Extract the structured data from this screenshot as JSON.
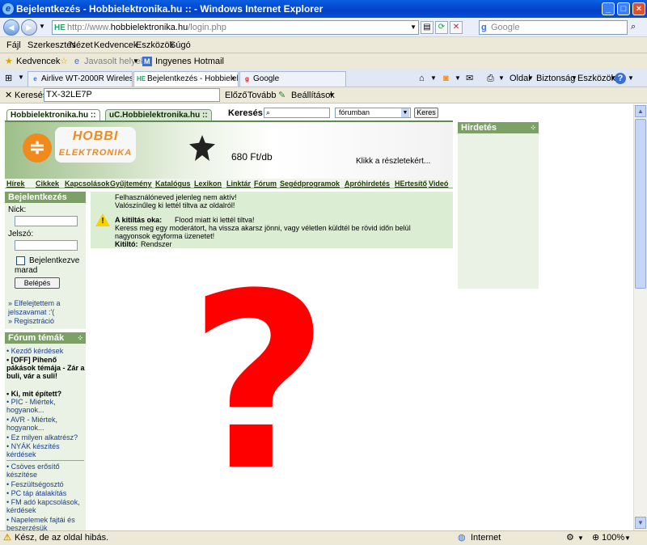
{
  "window": {
    "title": "Bejelentkezés - Hobbielektronika.hu :: - Windows Internet Explorer"
  },
  "address": {
    "site_badge": "HE",
    "prefix": "http://www.",
    "domain": "hobbielektronika.hu",
    "path": "/login.php"
  },
  "search_engine": {
    "placeholder": "Google"
  },
  "menu": [
    "Fájl",
    "Szerkesztés",
    "Nézet",
    "Kedvencek",
    "Eszközök",
    "Súgó"
  ],
  "favorites": {
    "label": "Kedvencek",
    "suggested": "Javasolt helyek",
    "hotmail": "Ingyenes Hotmail"
  },
  "tabs": [
    {
      "label": "Airlive WT-2000R Wireless Br..."
    },
    {
      "label": "Bejelentkezés - Hobbielek..."
    },
    {
      "label": "Google"
    }
  ],
  "command_bar": {
    "page": "Oldal",
    "safety": "Biztonság",
    "tools": "Eszközök"
  },
  "find_bar": {
    "label": "Keresés:",
    "value": "TX-32LE7P",
    "prev": "Előző",
    "next": "Tovább",
    "settings": "Beállítások"
  },
  "site": {
    "tabs": [
      "Hobbielektronika.hu ::",
      "uC.Hobbielektronika.hu ::"
    ],
    "search_label": "Keresés:",
    "search_scope": "fórumban",
    "search_button": "Keres",
    "logo_line1": "HOBBI",
    "logo_line2": "ELEKTRONIKA",
    "ad_price": "680 Ft/db",
    "ad_details": "Klikk a részletekért...",
    "nav": [
      "Hírek",
      "Cikkek",
      "Kapcsolások",
      "Gyűjtemény",
      "Katalógus",
      "Lexikon",
      "Linktár",
      "Fórum",
      "Segédprogramok",
      "Apróhirdetés",
      "HErtesítő",
      "Videó"
    ],
    "login": {
      "title": "Bejelentkezés",
      "nick_label": "Nick:",
      "pass_label": "Jelszó:",
      "remember": "Bejelentkezve marad",
      "button": "Belépés",
      "forgot": "» Elfelejtettem a jelszavamat :'(",
      "register": "» Regisztráció"
    },
    "forum": {
      "title": "Fórum témák",
      "items": [
        "• Kezdő kérdések",
        "• [OFF] Pihenő pákások témája - Zár a buli, vár a suli!",
        "• Ki, mit épített?",
        "• PIC - Miértek, hogyanok...",
        "• AVR - Miértek, hogyanok...",
        "• Ez milyen alkatrész?",
        "• NYÁK készítés kérdések",
        "• Csöves erősítő készítése",
        "• Feszültségosztó",
        "• PC táp átalakítás",
        "• FM adó kapcsolások, kérdések",
        "• Napelemek fajtái és beszerzésük"
      ]
    },
    "notice": {
      "line1": "Felhasználóneved jelenleg nem aktív!",
      "line2": "Valószínűleg ki lettél tiltva az oldalról!",
      "reason_label": "A kitiltás oka:",
      "reason": "Flood miatt ki lettél tiltva!",
      "help1": "Keress meg egy moderátort, ha vissza akarsz jönni, vagy véletlen küldtél be rövid időn belül",
      "help2": "nagyonsok egyforma üzenetet!",
      "banned_by_label": "Kitiltó:",
      "banned_by": "Rendszer"
    },
    "ads_title": "Hirdetés",
    "overlay": "?"
  },
  "status": {
    "text": "Kész, de az oldal hibás.",
    "zone": "Internet",
    "zoom": "100%"
  },
  "colors": {
    "overlay_mark": "#ff0000",
    "site_green": "#7da067",
    "titlebar": "#0041c8"
  }
}
